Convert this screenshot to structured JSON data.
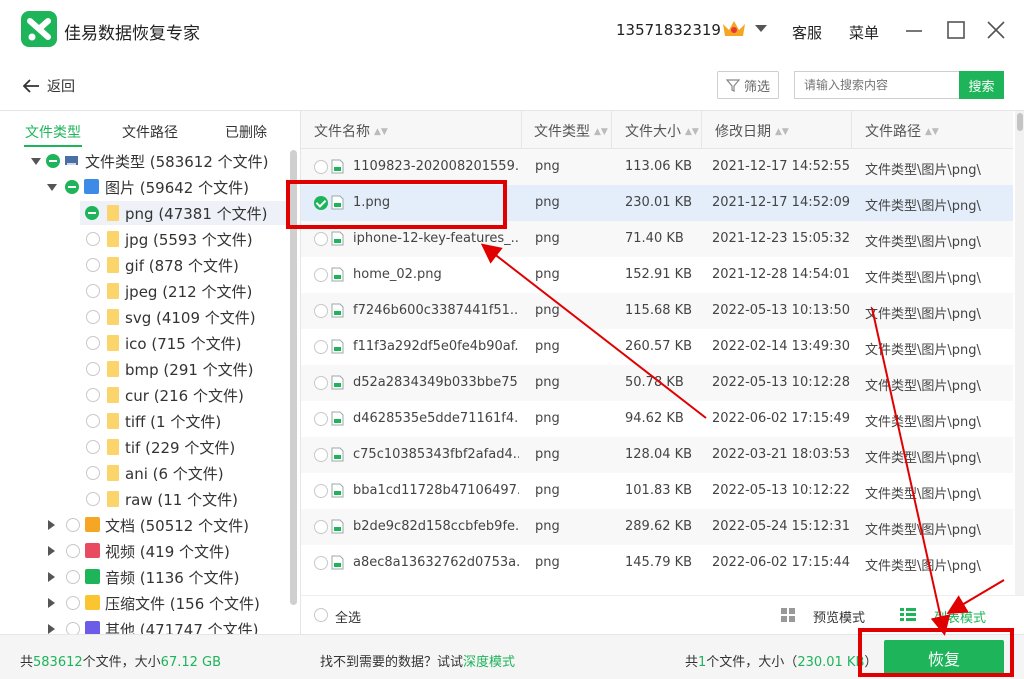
{
  "app": {
    "title": "佳易数据恢复专家",
    "phone": "13571832319",
    "service": "客服",
    "menu": "菜单"
  },
  "toolbar": {
    "back": "返回",
    "filter": "筛选",
    "search_placeholder": "请输入搜索内容",
    "search": "搜索"
  },
  "left_tabs": [
    {
      "label": "文件类型",
      "active": true
    },
    {
      "label": "文件路径",
      "active": false
    },
    {
      "label": "已删除",
      "active": false
    }
  ],
  "tree": [
    {
      "label": "文件类型 (583612 个文件)"
    },
    {
      "label": "图片 (59642 个文件)"
    },
    {
      "label": "png (47381 个文件)"
    },
    {
      "label": "jpg (5593 个文件)"
    },
    {
      "label": "gif (878 个文件)"
    },
    {
      "label": "jpeg (212 个文件)"
    },
    {
      "label": "svg (4109 个文件)"
    },
    {
      "label": "ico (715 个文件)"
    },
    {
      "label": "bmp (291 个文件)"
    },
    {
      "label": "cur (216 个文件)"
    },
    {
      "label": "tiff (1 个文件)"
    },
    {
      "label": "tif (229 个文件)"
    },
    {
      "label": "ani (6 个文件)"
    },
    {
      "label": "raw (11 个文件)"
    },
    {
      "label": "文档 (50512 个文件)"
    },
    {
      "label": "视频 (419 个文件)"
    },
    {
      "label": "音频 (1136 个文件)"
    },
    {
      "label": "压缩文件 (156 个文件)"
    },
    {
      "label": "其他 (471747 个文件)"
    }
  ],
  "table": {
    "headers": [
      "文件名称",
      "文件类型",
      "文件大小",
      "修改日期",
      "文件路径"
    ],
    "rows": [
      {
        "name": "1109823-202008201559...",
        "type": "png",
        "size": "113.06 KB",
        "date": "2021-12-17 14:52:55",
        "path": "文件类型\\图片\\png\\"
      },
      {
        "name": "1.png",
        "type": "png",
        "size": "230.01 KB",
        "date": "2021-12-17 14:52:09",
        "path": "文件类型\\图片\\png\\"
      },
      {
        "name": "iphone-12-key-features_...",
        "type": "png",
        "size": "71.40 KB",
        "date": "2021-12-23 15:05:32",
        "path": "文件类型\\图片\\png\\"
      },
      {
        "name": "home_02.png",
        "type": "png",
        "size": "152.91 KB",
        "date": "2021-12-28 14:54:01",
        "path": "文件类型\\图片\\png\\"
      },
      {
        "name": "f7246b600c3387441f51...",
        "type": "png",
        "size": "115.68 KB",
        "date": "2022-05-13 10:13:50",
        "path": "文件类型\\图片\\png\\"
      },
      {
        "name": "f11f3a292df5e0fe4b90af...",
        "type": "png",
        "size": "260.57 KB",
        "date": "2022-02-14 13:49:30",
        "path": "文件类型\\图片\\png\\"
      },
      {
        "name": "d52a2834349b033bbe75...",
        "type": "png",
        "size": "50.78 KB",
        "date": "2022-05-13 10:12:28",
        "path": "文件类型\\图片\\png\\"
      },
      {
        "name": "d4628535e5dde71161f4...",
        "type": "png",
        "size": "94.62 KB",
        "date": "2022-06-02 17:15:49",
        "path": "文件类型\\图片\\png\\"
      },
      {
        "name": "c75c10385343fbf2afad4...",
        "type": "png",
        "size": "128.04 KB",
        "date": "2022-03-21 18:03:53",
        "path": "文件类型\\图片\\png\\"
      },
      {
        "name": "bba1cd11728b47106497...",
        "type": "png",
        "size": "101.83 KB",
        "date": "2022-05-13 10:12:22",
        "path": "文件类型\\图片\\png\\"
      },
      {
        "name": "b2de9c82d158ccbfeb9fe...",
        "type": "png",
        "size": "289.62 KB",
        "date": "2022-05-24 15:12:31",
        "path": "文件类型\\图片\\png\\"
      },
      {
        "name": "a8ec8a13632762d0753a...",
        "type": "png",
        "size": "145.79 KB",
        "date": "2022-06-02 17:15:44",
        "path": "文件类型\\图片\\png\\"
      }
    ]
  },
  "footer": {
    "select_all": "全选",
    "preview_mode": "预览模式",
    "list_mode": "列表模式"
  },
  "status": {
    "total_prefix": "共",
    "total_count": "583612",
    "total_mid": "个文件，大小",
    "total_size": "67.12 GB",
    "hint": "找不到需要的数据？试试",
    "deep_mode": "深度模式",
    "sel_prefix": "共",
    "sel_count": "1",
    "sel_mid": "个文件，大小（",
    "sel_size": "230.01 KB",
    "sel_suffix": "）",
    "recover": "恢复"
  },
  "colors": {
    "accent": "#1db45a",
    "annotation": "#e00000"
  }
}
